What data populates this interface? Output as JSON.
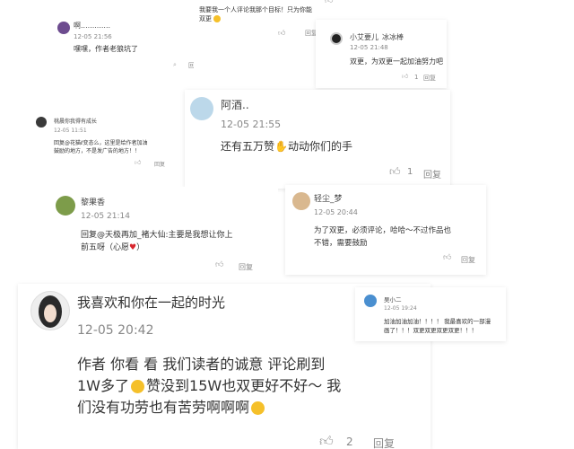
{
  "c1": {
    "name": "啊.............",
    "time": "12-05 21:56",
    "text": "嘿嘿，作者老狼坑了",
    "reply": "回复"
  },
  "c0": {
    "text_l1": "我要我一个人评论我那个目标！只为你能",
    "text_l2": "双更",
    "like": "",
    "reply": "回复"
  },
  "c2": {
    "name": "小艾要儿",
    "name2": "冰冰棒",
    "time": "12-05 21:48",
    "text": "双更，为双更一起加油努力吧",
    "like_count": "1",
    "reply": "回复"
  },
  "c3": {
    "name": "桃晨你我得有成长",
    "time": "12-05 11:51",
    "text_l1": "回复@花猫ℓ变态么，这里是给作者加油",
    "text_l2": "鼓励的地方，不是发广告的地方！！",
    "reply": "回复"
  },
  "c4": {
    "name": "阿酒..",
    "time": "12-05 21:55",
    "text_a": "还有五万赞",
    "text_b": "动动你们的手",
    "like_count": "1",
    "reply": "回复"
  },
  "c5": {
    "name": "黎果香",
    "time": "12-05 21:14",
    "text_l1": "回复@天极再加_褚大仙:主要是我想让你上",
    "text_l2": "前五呀（心愿",
    "text_l2_end": "）",
    "reply": "回复"
  },
  "c6": {
    "name": "轻尘_梦",
    "time": "12-05 20:44",
    "text_l1": "为了双更，必须评论，哈哈～不过作品也",
    "text_l2": "不错，需要鼓励",
    "reply": "回复"
  },
  "c7": {
    "name": "我喜欢和你在一起的时光",
    "time": "12-05 20:42",
    "text_l1": "作者 你看 看 我们读者的诚意 评论刷到",
    "text_l2a": "1W多了",
    "text_l2b": "赞没到15W也双更好不好～ 我",
    "text_l3": "们没有功劳也有苦劳啊啊啊",
    "like_count": "2",
    "reply": "回复"
  },
  "c8": {
    "name": "吴小二",
    "time": "12-05 19:24",
    "text_l1": "加油加油加油！！！！ 我最喜欢的一部漫",
    "text_l2": "画了！！！双更双更双更双更！！！"
  }
}
